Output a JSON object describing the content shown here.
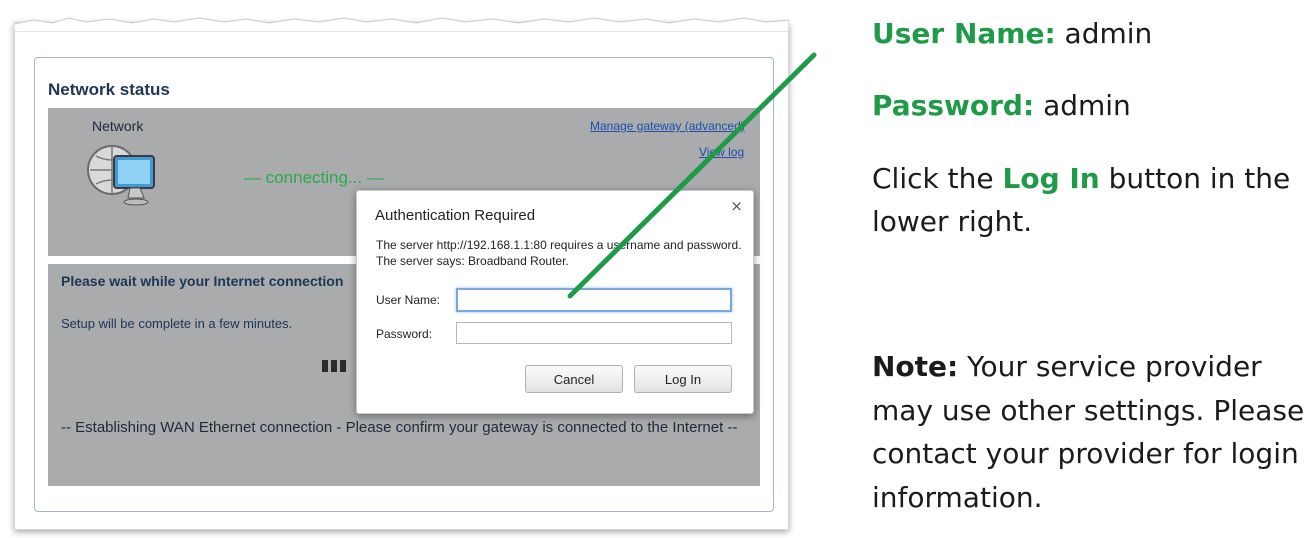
{
  "network_status": {
    "title": "Network status",
    "network_label": "Network",
    "manage_gateway_link": "Manage gateway (advanced)",
    "view_log_link": "View log",
    "connecting_text": "— connecting... —",
    "wait_message": "Please wait while your Internet connection",
    "setup_message": "Setup will be complete in a few minutes.",
    "wan_message": "-- Establishing WAN Ethernet connection - Please confirm your gateway is connected to the Internet --"
  },
  "dialog": {
    "title": "Authentication Required",
    "close_glyph": "×",
    "message": "The server http://192.168.1.1:80 requires a username and password. The server says: Broadband Router.",
    "user_name_label": "User Name:",
    "user_name_value": "",
    "password_label": "Password:",
    "password_value": "",
    "cancel_label": "Cancel",
    "login_label": "Log In"
  },
  "instructions": {
    "user_name_key": "User Name:",
    "user_name_value": "admin",
    "password_key": "Password:",
    "password_value": "admin",
    "click_prefix": "Click the",
    "click_button": "Log In",
    "click_suffix": "button in the",
    "click_line2": "lower right.",
    "note_key": "Note:",
    "note_line1": "Your service provider",
    "note_line2": "may use other settings. Please",
    "note_line3": "contact your provider for login",
    "note_line4": "information."
  },
  "colors": {
    "accent_green": "#1f9a48",
    "arrow_green": "#1f9a48",
    "panel_gray": "#a9abad",
    "link_blue": "#1f4ea8"
  },
  "icons": {
    "network": "network-globe-monitor-icon",
    "close": "close-icon"
  }
}
